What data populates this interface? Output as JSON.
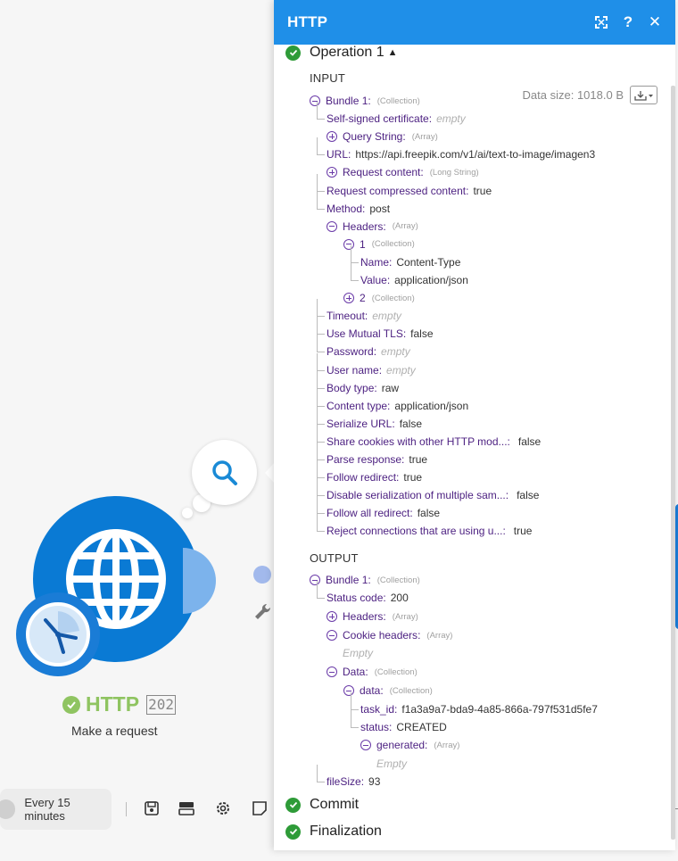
{
  "canvas": {
    "module_name": "HTTP",
    "module_count": "202",
    "module_subtitle": "Make a request",
    "schedule_label": "Every 15 minutes"
  },
  "panel": {
    "title": "HTTP",
    "operation_label": "Operation 1",
    "data_size": "Data size: 1018.0 B",
    "input_label": "INPUT",
    "output_label": "OUTPUT",
    "commit_label": "Commit",
    "finalization_label": "Finalization",
    "input_rows": [
      {
        "toggle": "minus",
        "indent": 0,
        "key": "Bundle 1",
        "type": "(Collection)"
      },
      {
        "indent": 1,
        "key": "Self-signed certificate",
        "empty": "empty"
      },
      {
        "toggle": "plus",
        "indent": 1,
        "key": "Query String",
        "type": "(Array)"
      },
      {
        "indent": 1,
        "key": "URL",
        "value": "https://api.freepik.com/v1/ai/text-to-image/imagen3"
      },
      {
        "toggle": "plus",
        "indent": 1,
        "key": "Request content",
        "type": "(Long String)"
      },
      {
        "indent": 1,
        "key": "Request compressed content",
        "value": "true"
      },
      {
        "indent": 1,
        "key": "Method",
        "value": "post"
      },
      {
        "toggle": "minus",
        "indent": 1,
        "key": "Headers",
        "type": "(Array)"
      },
      {
        "toggle": "minus",
        "indent": 2,
        "key": "1",
        "type": "(Collection)"
      },
      {
        "indent": 3,
        "key": "Name",
        "value": "Content-Type"
      },
      {
        "indent": 3,
        "key": "Value",
        "value": "application/json"
      },
      {
        "toggle": "plus",
        "indent": 2,
        "key": "2",
        "type": "(Collection)"
      },
      {
        "indent": 1,
        "key": "Timeout",
        "empty": "empty"
      },
      {
        "indent": 1,
        "key": "Use Mutual TLS",
        "value": "false"
      },
      {
        "indent": 1,
        "key": "Password",
        "empty": "empty"
      },
      {
        "indent": 1,
        "key": "User name",
        "empty": "empty"
      },
      {
        "indent": 1,
        "key": "Body type",
        "value": "raw"
      },
      {
        "indent": 1,
        "key": "Content type",
        "value": "application/json"
      },
      {
        "indent": 1,
        "key": "Serialize URL",
        "value": "false"
      },
      {
        "indent": 1,
        "key": "Share cookies with other HTTP mod...",
        "value": "false"
      },
      {
        "indent": 1,
        "key": "Parse response",
        "value": "true"
      },
      {
        "indent": 1,
        "key": "Follow redirect",
        "value": "true"
      },
      {
        "indent": 1,
        "key": "Disable serialization of multiple sam...",
        "value": "false"
      },
      {
        "indent": 1,
        "key": "Follow all redirect",
        "value": "false"
      },
      {
        "indent": 1,
        "key": "Reject connections that are using u...",
        "value": "true"
      }
    ],
    "output_rows": [
      {
        "toggle": "minus",
        "indent": 0,
        "key": "Bundle 1",
        "type": "(Collection)"
      },
      {
        "indent": 1,
        "key": "Status code",
        "value": "200"
      },
      {
        "toggle": "plus",
        "indent": 1,
        "key": "Headers",
        "type": "(Array)"
      },
      {
        "toggle": "minus",
        "indent": 1,
        "key": "Cookie headers",
        "type": "(Array)"
      },
      {
        "note": "Empty",
        "indent": 1
      },
      {
        "toggle": "minus",
        "indent": 1,
        "key": "Data",
        "type": "(Collection)"
      },
      {
        "toggle": "minus",
        "indent": 2,
        "key": "data",
        "type": "(Collection)"
      },
      {
        "indent": 3,
        "key": "task_id",
        "value": "f1a3a9a7-bda9-4a85-866a-797f531d5fe7"
      },
      {
        "indent": 3,
        "key": "status",
        "value": "CREATED"
      },
      {
        "toggle": "minus",
        "indent": 3,
        "key": "generated",
        "type": "(Array)"
      },
      {
        "note": "Empty",
        "indent": 3
      },
      {
        "indent": 1,
        "key": "fileSize",
        "value": "93"
      }
    ]
  },
  "colors": {
    "header_blue": "#1f8fe8",
    "module_blue": "#0a7ad4",
    "success_green": "#2e9b38",
    "module_green": "#8fc461",
    "key_purple": "#4b1f80"
  }
}
